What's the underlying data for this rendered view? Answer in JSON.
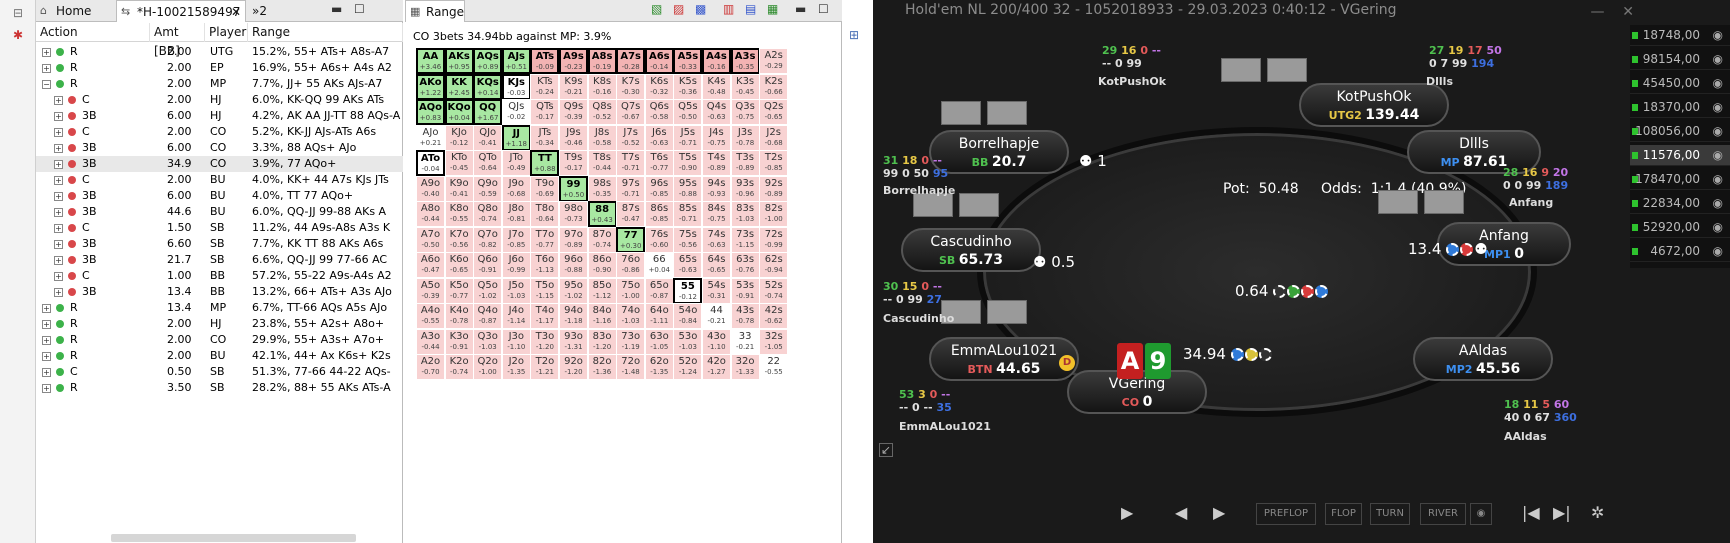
{
  "tree_tabs": {
    "home": "Home",
    "hand": "*H-10021589497",
    "more": "»2"
  },
  "columns": {
    "action": "Action",
    "amt": "Amt [BB]",
    "player": "Player",
    "range": "Range"
  },
  "rows": [
    {
      "exp": "+",
      "dot": "g",
      "act": "R",
      "amt": "2.00",
      "player": "UTG",
      "range": "15.2%, 55+ ATs+ A8s-A7"
    },
    {
      "exp": "+",
      "dot": "g",
      "act": "R",
      "amt": "2.00",
      "player": "EP",
      "range": "16.9%, 55+ A6s+ A4s A2"
    },
    {
      "exp": "−",
      "dot": "g",
      "act": "R",
      "amt": "2.00",
      "player": "MP",
      "range": "7.7%, JJ+ 55 AKs AJs-A7"
    },
    {
      "exp": "+",
      "dot": "r",
      "act": "C",
      "amt": "2.00",
      "player": "HJ",
      "range": "6.0%, KK-QQ 99 AKs ATs"
    },
    {
      "exp": "+",
      "dot": "r",
      "act": "3B",
      "amt": "6.00",
      "player": "HJ",
      "range": "4.2%, AK AA JJ-TT 88 AQs-A"
    },
    {
      "exp": "+",
      "dot": "r",
      "act": "C",
      "amt": "2.00",
      "player": "CO",
      "range": "5.2%, KK-JJ AJs-ATs A6s"
    },
    {
      "exp": "+",
      "dot": "r",
      "act": "3B",
      "amt": "6.00",
      "player": "CO",
      "range": "3.3%, 88 AQs+ AJo"
    },
    {
      "exp": "+",
      "dot": "r",
      "act": "3B",
      "amt": "34.9",
      "player": "CO",
      "range": "3.9%, 77 AQo+"
    },
    {
      "exp": "+",
      "dot": "r",
      "act": "C",
      "amt": "2.00",
      "player": "BU",
      "range": "4.0%, KK+ 44 A7s KJs JTs"
    },
    {
      "exp": "+",
      "dot": "r",
      "act": "3B",
      "amt": "6.00",
      "player": "BU",
      "range": "4.0%, TT 77 AQo+"
    },
    {
      "exp": "+",
      "dot": "r",
      "act": "3B",
      "amt": "44.6",
      "player": "BU",
      "range": "6.0%, QQ-JJ 99-88 AKs A"
    },
    {
      "exp": "+",
      "dot": "r",
      "act": "C",
      "amt": "1.50",
      "player": "SB",
      "range": "11.2%, 44 A9s-A8s A3s K"
    },
    {
      "exp": "+",
      "dot": "r",
      "act": "3B",
      "amt": "6.60",
      "player": "SB",
      "range": "7.7%, KK TT 88 AKs A6s"
    },
    {
      "exp": "+",
      "dot": "r",
      "act": "3B",
      "amt": "21.7",
      "player": "SB",
      "range": "6.6%, QQ-JJ 99 77-66 AC"
    },
    {
      "exp": "+",
      "dot": "r",
      "act": "C",
      "amt": "1.00",
      "player": "BB",
      "range": "57.2%, 55-22 A9s-A4s A2"
    },
    {
      "exp": "+",
      "dot": "r",
      "act": "3B",
      "amt": "13.4",
      "player": "BB",
      "range": "13.2%, 66+ ATs+ A3s AJo"
    },
    {
      "exp": "+",
      "dot": "g",
      "act": "R",
      "amt": "13.4",
      "player": "MP",
      "range": "6.7%, TT-66 AQs A5s AJo"
    },
    {
      "exp": "+",
      "dot": "g",
      "act": "R",
      "amt": "2.00",
      "player": "HJ",
      "range": "23.8%, 55+ A2s+ A8o+"
    },
    {
      "exp": "+",
      "dot": "g",
      "act": "R",
      "amt": "2.00",
      "player": "CO",
      "range": "29.9%, 55+ A3s+ A7o+"
    },
    {
      "exp": "+",
      "dot": "g",
      "act": "R",
      "amt": "2.00",
      "player": "BU",
      "range": "42.1%, 44+ Ax K6s+ K2s"
    },
    {
      "exp": "+",
      "dot": "g",
      "act": "C",
      "amt": "0.50",
      "player": "SB",
      "range": "51.3%, 77-66 44-22 AQs-"
    },
    {
      "exp": "+",
      "dot": "g",
      "act": "R",
      "amt": "3.50",
      "player": "SB",
      "range": "28.2%, 88+ 55 AKs ATs-A"
    }
  ],
  "range_panel": {
    "tab": "Range",
    "title": "CO 3bets 34.94bb against MP: 3.9%"
  },
  "grid": [
    [
      [
        "AA",
        "+3.46",
        "G"
      ],
      [
        "AKs",
        "+0.95",
        "G"
      ],
      [
        "AQs",
        "+0.89",
        "G"
      ],
      [
        "AJs",
        "+0.51",
        "G"
      ],
      [
        "ATs",
        "-0.09",
        "P"
      ],
      [
        "A9s",
        "-0.23",
        "P"
      ],
      [
        "A8s",
        "-0.19",
        "P"
      ],
      [
        "A7s",
        "-0.28",
        "P"
      ],
      [
        "A6s",
        "-0.14",
        "P"
      ],
      [
        "A5s",
        "-0.33",
        "P"
      ],
      [
        "A4s",
        "-0.16",
        "P"
      ],
      [
        "A3s",
        "-0.35",
        "P"
      ],
      [
        "A2s",
        "-0.29",
        "L"
      ]
    ],
    [
      [
        "AKo",
        "+1.22",
        "G"
      ],
      [
        "KK",
        "+2.45",
        "G"
      ],
      [
        "KQs",
        "+0.14",
        "G"
      ],
      [
        "KJs",
        "-0.03",
        "W"
      ],
      [
        "KTs",
        "-0.24",
        "L"
      ],
      [
        "K9s",
        "-0.21",
        "L"
      ],
      [
        "K8s",
        "-0.16",
        "L"
      ],
      [
        "K7s",
        "-0.30",
        "L"
      ],
      [
        "K6s",
        "-0.32",
        "L"
      ],
      [
        "K5s",
        "-0.36",
        "L"
      ],
      [
        "K4s",
        "-0.48",
        "L"
      ],
      [
        "K3s",
        "-0.45",
        "L"
      ],
      [
        "K2s",
        "-0.66",
        "L"
      ]
    ],
    [
      [
        "AQo",
        "+0.83",
        "G"
      ],
      [
        "KQo",
        "+0.04",
        "G"
      ],
      [
        "QQ",
        "+1.67",
        "G"
      ],
      [
        "QJs",
        "-0.02",
        "W"
      ],
      [
        "QTs",
        "-0.17",
        "L"
      ],
      [
        "Q9s",
        "-0.39",
        "L"
      ],
      [
        "Q8s",
        "-0.52",
        "L"
      ],
      [
        "Q7s",
        "-0.67",
        "L"
      ],
      [
        "Q6s",
        "-0.58",
        "L"
      ],
      [
        "Q5s",
        "-0.50",
        "L"
      ],
      [
        "Q4s",
        "-0.63",
        "L"
      ],
      [
        "Q3s",
        "-0.75",
        "L"
      ],
      [
        "Q2s",
        "-0.65",
        "L"
      ]
    ],
    [
      [
        "AJo",
        "+0.21",
        "W"
      ],
      [
        "KJo",
        "-0.12",
        "L"
      ],
      [
        "QJo",
        "-0.41",
        "L"
      ],
      [
        "JJ",
        "+1.18",
        "G"
      ],
      [
        "JTs",
        "-0.34",
        "L"
      ],
      [
        "J9s",
        "-0.46",
        "L"
      ],
      [
        "J8s",
        "-0.58",
        "L"
      ],
      [
        "J7s",
        "-0.52",
        "L"
      ],
      [
        "J6s",
        "-0.63",
        "L"
      ],
      [
        "J5s",
        "-0.71",
        "L"
      ],
      [
        "J4s",
        "-0.75",
        "L"
      ],
      [
        "J3s",
        "-0.78",
        "L"
      ],
      [
        "J2s",
        "-0.68",
        "L"
      ]
    ],
    [
      [
        "ATo",
        "-0.04",
        "W"
      ],
      [
        "KTo",
        "-0.45",
        "L"
      ],
      [
        "QTo",
        "-0.64",
        "L"
      ],
      [
        "JTo",
        "-0.49",
        "L"
      ],
      [
        "TT",
        "+0.88",
        "G"
      ],
      [
        "T9s",
        "-0.17",
        "L"
      ],
      [
        "T8s",
        "-0.44",
        "L"
      ],
      [
        "T7s",
        "-0.71",
        "L"
      ],
      [
        "T6s",
        "-0.77",
        "L"
      ],
      [
        "T5s",
        "-0.90",
        "L"
      ],
      [
        "T4s",
        "-0.89",
        "L"
      ],
      [
        "T3s",
        "-0.89",
        "L"
      ],
      [
        "T2s",
        "-0.85",
        "L"
      ]
    ],
    [
      [
        "A9o",
        "-0.40",
        "L"
      ],
      [
        "K9o",
        "-0.41",
        "L"
      ],
      [
        "Q9o",
        "-0.59",
        "L"
      ],
      [
        "J9o",
        "-0.68",
        "L"
      ],
      [
        "T9o",
        "-0.69",
        "L"
      ],
      [
        "99",
        "+0.50",
        "G"
      ],
      [
        "98s",
        "-0.35",
        "L"
      ],
      [
        "97s",
        "-0.71",
        "L"
      ],
      [
        "96s",
        "-0.85",
        "L"
      ],
      [
        "95s",
        "-0.88",
        "L"
      ],
      [
        "94s",
        "-0.93",
        "L"
      ],
      [
        "93s",
        "-0.96",
        "L"
      ],
      [
        "92s",
        "-0.89",
        "L"
      ]
    ],
    [
      [
        "A8o",
        "-0.44",
        "L"
      ],
      [
        "K8o",
        "-0.55",
        "L"
      ],
      [
        "Q8o",
        "-0.74",
        "L"
      ],
      [
        "J8o",
        "-0.81",
        "L"
      ],
      [
        "T8o",
        "-0.64",
        "L"
      ],
      [
        "98o",
        "-0.73",
        "L"
      ],
      [
        "88",
        "+0.43",
        "G"
      ],
      [
        "87s",
        "-0.47",
        "L"
      ],
      [
        "86s",
        "-0.85",
        "L"
      ],
      [
        "85s",
        "-0.71",
        "L"
      ],
      [
        "84s",
        "-0.75",
        "L"
      ],
      [
        "83s",
        "-1.03",
        "L"
      ],
      [
        "82s",
        "-1.00",
        "L"
      ]
    ],
    [
      [
        "A7o",
        "-0.50",
        "L"
      ],
      [
        "K7o",
        "-0.56",
        "L"
      ],
      [
        "Q7o",
        "-0.82",
        "L"
      ],
      [
        "J7o",
        "-0.85",
        "L"
      ],
      [
        "T7o",
        "-0.77",
        "L"
      ],
      [
        "97o",
        "-0.89",
        "L"
      ],
      [
        "87o",
        "-0.74",
        "L"
      ],
      [
        "77",
        "+0.30",
        "G"
      ],
      [
        "76s",
        "-0.60",
        "L"
      ],
      [
        "75s",
        "-0.56",
        "L"
      ],
      [
        "74s",
        "-0.63",
        "L"
      ],
      [
        "73s",
        "-1.15",
        "L"
      ],
      [
        "72s",
        "-0.99",
        "L"
      ]
    ],
    [
      [
        "A6o",
        "-0.47",
        "L"
      ],
      [
        "K6o",
        "-0.65",
        "L"
      ],
      [
        "Q6o",
        "-0.91",
        "L"
      ],
      [
        "J6o",
        "-0.99",
        "L"
      ],
      [
        "T6o",
        "-1.13",
        "L"
      ],
      [
        "96o",
        "-0.88",
        "L"
      ],
      [
        "86o",
        "-0.90",
        "L"
      ],
      [
        "76o",
        "-0.86",
        "L"
      ],
      [
        "66",
        "+0.04",
        "W"
      ],
      [
        "65s",
        "-0.63",
        "L"
      ],
      [
        "64s",
        "-0.65",
        "L"
      ],
      [
        "63s",
        "-0.76",
        "L"
      ],
      [
        "62s",
        "-0.94",
        "L"
      ]
    ],
    [
      [
        "A5o",
        "-0.39",
        "L"
      ],
      [
        "K5o",
        "-0.77",
        "L"
      ],
      [
        "Q5o",
        "-1.02",
        "L"
      ],
      [
        "J5o",
        "-1.03",
        "L"
      ],
      [
        "T5o",
        "-1.15",
        "L"
      ],
      [
        "95o",
        "-1.02",
        "L"
      ],
      [
        "85o",
        "-1.12",
        "L"
      ],
      [
        "75o",
        "-1.00",
        "L"
      ],
      [
        "65o",
        "-0.87",
        "L"
      ],
      [
        "55",
        "-0.12",
        "W"
      ],
      [
        "54s",
        "-0.31",
        "L"
      ],
      [
        "53s",
        "-0.91",
        "L"
      ],
      [
        "52s",
        "-0.74",
        "L"
      ]
    ],
    [
      [
        "A4o",
        "-0.55",
        "L"
      ],
      [
        "K4o",
        "-0.78",
        "L"
      ],
      [
        "Q4o",
        "-0.87",
        "L"
      ],
      [
        "J4o",
        "-1.14",
        "L"
      ],
      [
        "T4o",
        "-1.17",
        "L"
      ],
      [
        "94o",
        "-1.18",
        "L"
      ],
      [
        "84o",
        "-1.16",
        "L"
      ],
      [
        "74o",
        "-1.03",
        "L"
      ],
      [
        "64o",
        "-1.11",
        "L"
      ],
      [
        "54o",
        "-0.84",
        "L"
      ],
      [
        "44",
        "-0.21",
        "W"
      ],
      [
        "43s",
        "-0.78",
        "L"
      ],
      [
        "42s",
        "-0.62",
        "L"
      ]
    ],
    [
      [
        "A3o",
        "-0.44",
        "L"
      ],
      [
        "K3o",
        "-0.91",
        "L"
      ],
      [
        "Q3o",
        "-1.03",
        "L"
      ],
      [
        "J3o",
        "-1.10",
        "L"
      ],
      [
        "T3o",
        "-1.20",
        "L"
      ],
      [
        "93o",
        "-1.31",
        "L"
      ],
      [
        "83o",
        "-1.20",
        "L"
      ],
      [
        "73o",
        "-1.19",
        "L"
      ],
      [
        "63o",
        "-1.05",
        "L"
      ],
      [
        "53o",
        "-1.03",
        "L"
      ],
      [
        "43o",
        "-1.10",
        "L"
      ],
      [
        "33",
        "-0.21",
        "W"
      ],
      [
        "32s",
        "-1.05",
        "L"
      ]
    ],
    [
      [
        "A2o",
        "-0.70",
        "L"
      ],
      [
        "K2o",
        "-0.74",
        "L"
      ],
      [
        "Q2o",
        "-1.00",
        "L"
      ],
      [
        "J2o",
        "-1.35",
        "L"
      ],
      [
        "T2o",
        "-1.21",
        "L"
      ],
      [
        "92o",
        "-1.20",
        "L"
      ],
      [
        "82o",
        "-1.36",
        "L"
      ],
      [
        "72o",
        "-1.48",
        "L"
      ],
      [
        "62o",
        "-1.35",
        "L"
      ],
      [
        "52o",
        "-1.24",
        "L"
      ],
      [
        "42o",
        "-1.27",
        "L"
      ],
      [
        "32o",
        "-1.33",
        "L"
      ],
      [
        "22",
        "-0.55",
        "W"
      ]
    ]
  ],
  "selected_hands": [
    "AA",
    "AKs",
    "AQs",
    "AJs",
    "ATs",
    "A9s",
    "A8s",
    "A7s",
    "A6s",
    "A5s",
    "A4s",
    "A3s",
    "AKo",
    "KK",
    "KQs",
    "KJs",
    "AQo",
    "KQo",
    "QQ",
    "JJ",
    "ATo",
    "TT",
    "99",
    "88",
    "77",
    "55"
  ],
  "colors": {
    "G": "#a8e8a2",
    "W": "#ffffff",
    "P": "#f3b3b3",
    "L": "#f8d2d2",
    "accent": "#3c6fb5"
  },
  "poker": {
    "title": "Hold'em NL 200/400 32 - 1052018933 - 29.03.2023 0:40:12 - VGering",
    "pot_label": "Pot:",
    "pot": "50.48",
    "odds_label": "Odds:",
    "odds": "1:1.4 (40.9%)",
    "seats": [
      {
        "name": "KotPushOk",
        "pos": "UTG2",
        "stack": "139.44",
        "poscolor": "#e7c846"
      },
      {
        "name": "Dllls",
        "pos": "MP",
        "stack": "87.61",
        "poscolor": "#3d8ff0"
      },
      {
        "name": "Anfang",
        "pos": "MP1",
        "stack": "0",
        "poscolor": "#3d8ff0"
      },
      {
        "name": "AAldas",
        "pos": "MP2",
        "stack": "45.56",
        "poscolor": "#3d8ff0"
      },
      {
        "name": "VGering",
        "pos": "CO",
        "stack": "0",
        "poscolor": "#e45a5a"
      },
      {
        "name": "EmmALou1021",
        "pos": "BTN",
        "stack": "44.65",
        "poscolor": "#e45a5a"
      },
      {
        "name": "Cascudinho",
        "pos": "SB",
        "stack": "65.73",
        "poscolor": "#4fc14f"
      },
      {
        "name": "Borrelhapje",
        "pos": "BB",
        "stack": "20.7",
        "poscolor": "#4fc14f"
      }
    ],
    "hud": {
      "kot": {
        "a": "29",
        "b": "16",
        "c": "0",
        "d": "--",
        "e": "--",
        "f": "0",
        "g": "99",
        "h": "",
        "name": "KotPushOk"
      },
      "dll": {
        "a": "27",
        "b": "19",
        "c": "17",
        "d": "50",
        "e": "0",
        "f": "7",
        "g": "99",
        "h": "194",
        "name": "Dllls"
      },
      "bor": {
        "a": "31",
        "b": "18",
        "c": "0",
        "d": "--",
        "e": "99",
        "f": "0",
        "g": "50",
        "h": "95",
        "name": "Borrelhapje"
      },
      "anf": {
        "a": "28",
        "b": "16",
        "c": "9",
        "d": "20",
        "e": "0",
        "f": "0",
        "g": "99",
        "h": "189",
        "name": "Anfang"
      },
      "cas": {
        "a": "30",
        "b": "15",
        "c": "0",
        "d": "--",
        "e": "--",
        "f": "0",
        "g": "99",
        "h": "27",
        "name": "Cascudinho"
      },
      "emm": {
        "a": "53",
        "b": "3",
        "c": "0",
        "d": "--",
        "e": "--",
        "f": "0",
        "g": "--",
        "h": "35",
        "name": "EmmALou1021"
      },
      "aal": {
        "a": "18",
        "b": "11",
        "c": "5",
        "d": "60",
        "e": "40",
        "f": "0",
        "g": "67",
        "h": "360",
        "name": "AAldas"
      }
    },
    "bets": {
      "bor": "1",
      "cas": "0.5",
      "anf": "13.4",
      "mid": "0.64",
      "hero": "34.94"
    },
    "hero_cards": [
      "A",
      "9"
    ],
    "dealer": "D",
    "history": [
      {
        "v": "18748,00",
        "act": false
      },
      {
        "v": "98154,00",
        "act": false
      },
      {
        "v": "45450,00",
        "act": false
      },
      {
        "v": "18370,00",
        "act": false
      },
      {
        "v": "108056,00",
        "act": false
      },
      {
        "v": "11576,00",
        "act": true
      },
      {
        "v": "178470,00",
        "act": false
      },
      {
        "v": "22834,00",
        "act": false
      },
      {
        "v": "52920,00",
        "act": false
      },
      {
        "v": "4672,00",
        "act": false
      }
    ],
    "controls": {
      "preflop": "PREFLOP",
      "flop": "FLOP",
      "turn": "TURN",
      "river": "RIVER"
    }
  }
}
